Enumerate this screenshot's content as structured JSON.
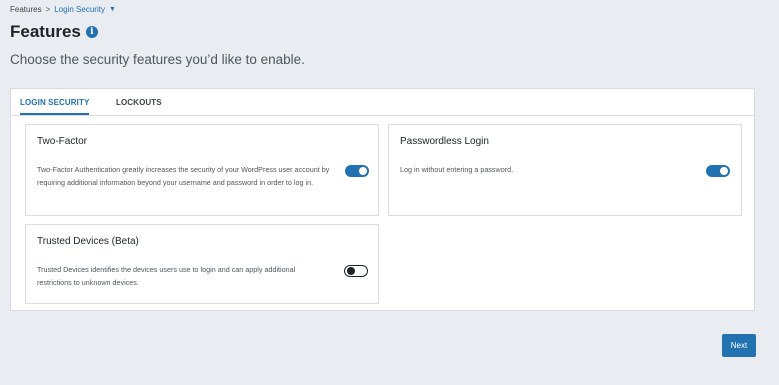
{
  "breadcrumb": {
    "root": "Features",
    "separator": ">",
    "current": "Login Security",
    "caret": "▼"
  },
  "header": {
    "title": "Features",
    "info_icon": "i",
    "subtitle": "Choose the security features you’d like to enable."
  },
  "tabs": [
    {
      "label": "LOGIN SECURITY",
      "active": true
    },
    {
      "label": "LOCKOUTS",
      "active": false
    }
  ],
  "cards": [
    {
      "title": "Two-Factor",
      "description": "Two-Factor Authentication greatly increases the security of your WordPress user account by requiring additional information beyond your username and password in order to log in.",
      "enabled": true
    },
    {
      "title": "Passwordless Login",
      "description": "Log in without entering a password.",
      "enabled": true
    },
    {
      "title": "Trusted Devices (Beta)",
      "description": "Trusted Devices identifies the devices users use to login and can apply additional restrictions to unknown devices.",
      "enabled": false
    }
  ],
  "actions": {
    "next_label": "Next"
  },
  "colors": {
    "accent": "#2271b1",
    "background": "#e9ecf1"
  }
}
